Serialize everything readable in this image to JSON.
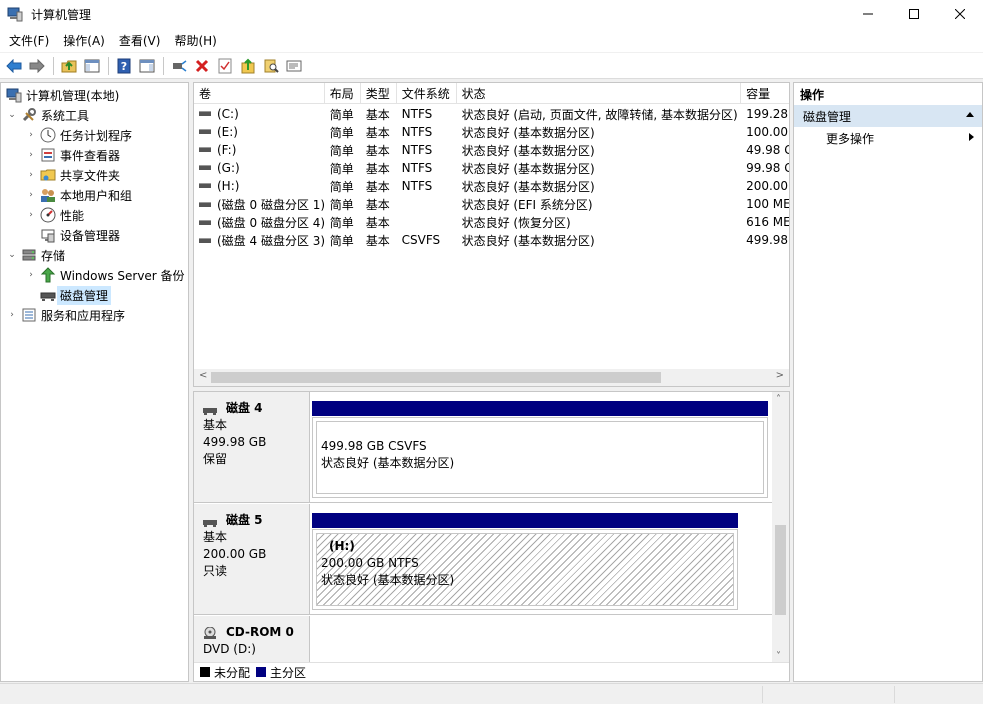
{
  "window": {
    "title": "计算机管理"
  },
  "menu": [
    "文件(F)",
    "操作(A)",
    "查看(V)",
    "帮助(H)"
  ],
  "tree": {
    "root": "计算机管理(本地)",
    "system_tools": "系统工具",
    "task_scheduler": "任务计划程序",
    "event_viewer": "事件查看器",
    "shared_folders": "共享文件夹",
    "local_users": "本地用户和组",
    "performance": "性能",
    "device_manager": "设备管理器",
    "storage": "存储",
    "windows_backup": "Windows Server 备份",
    "disk_management": "磁盘管理",
    "services_apps": "服务和应用程序"
  },
  "volumes": {
    "columns": [
      "卷",
      "布局",
      "类型",
      "文件系统",
      "状态",
      "容量"
    ],
    "rows": [
      [
        "(C:)",
        "简单",
        "基本",
        "NTFS",
        "状态良好 (启动, 页面文件, 故障转储, 基本数据分区)",
        "199.28"
      ],
      [
        "(E:)",
        "简单",
        "基本",
        "NTFS",
        "状态良好 (基本数据分区)",
        "100.00"
      ],
      [
        "(F:)",
        "简单",
        "基本",
        "NTFS",
        "状态良好 (基本数据分区)",
        "49.98 G"
      ],
      [
        "(G:)",
        "简单",
        "基本",
        "NTFS",
        "状态良好 (基本数据分区)",
        "99.98 G"
      ],
      [
        "(H:)",
        "简单",
        "基本",
        "NTFS",
        "状态良好 (基本数据分区)",
        "200.00"
      ],
      [
        "(磁盘 0 磁盘分区 1)",
        "简单",
        "基本",
        "",
        "状态良好 (EFI 系统分区)",
        "100 ME"
      ],
      [
        "(磁盘 0 磁盘分区 4)",
        "简单",
        "基本",
        "",
        "状态良好 (恢复分区)",
        "616 ME"
      ],
      [
        "(磁盘 4 磁盘分区 3)",
        "简单",
        "基本",
        "CSVFS",
        "状态良好 (基本数据分区)",
        "499.98"
      ]
    ]
  },
  "disks": {
    "disk4": {
      "name": "磁盘 4",
      "type": "基本",
      "size": "499.98 GB",
      "state": "保留",
      "part_size": "499.98 GB CSVFS",
      "part_status": "状态良好 (基本数据分区)"
    },
    "disk5": {
      "name": "磁盘 5",
      "type": "基本",
      "size": "200.00 GB",
      "state": "只读",
      "part_label": "(H:)",
      "part_size": "200.00 GB NTFS",
      "part_status": "状态良好 (基本数据分区)"
    },
    "cdrom0": {
      "name": "CD-ROM 0",
      "drive": "DVD (D:)"
    }
  },
  "legend": {
    "unallocated": "未分配",
    "primary": "主分区"
  },
  "actions": {
    "title": "操作",
    "section": "磁盘管理",
    "more": "更多操作"
  },
  "colors": {
    "primary_partition": "#000080",
    "unallocated": "#000000",
    "selection": "#cce8ff",
    "action_header": "#d8e6f3"
  }
}
